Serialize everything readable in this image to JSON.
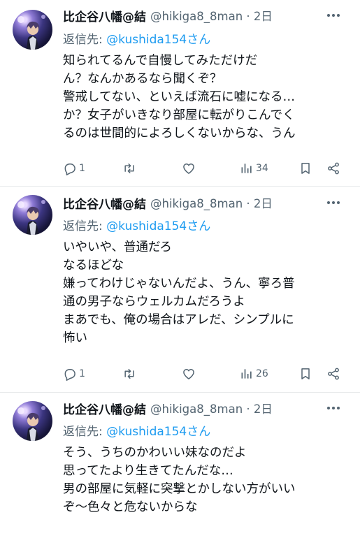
{
  "tweets": [
    {
      "display_name": "比企谷八幡@結",
      "handle_time": "@hikiga8_8man · 2日",
      "reply_prefix": "返信先: ",
      "reply_mention": "@kushida154さん",
      "lines": [
        "知られてるんで自慢してみただけだ",
        "ん？なんかあるなら聞くぞ？",
        "警戒してない、といえば流石に嘘になる…",
        "か？女子がいきなり部屋に転がりこんでく",
        "るのは世間的によろしくないからな、うん"
      ],
      "reply_count": "1",
      "views_count": "34"
    },
    {
      "display_name": "比企谷八幡@結",
      "handle_time": "@hikiga8_8man · 2日",
      "reply_prefix": "返信先: ",
      "reply_mention": "@kushida154さん",
      "lines": [
        "いやいや、普通だろ",
        "なるほどな",
        "嫌ってわけじゃないんだよ、うん、寧ろ普",
        "通の男子ならウェルカムだろうよ",
        "まあでも、俺の場合はアレだ、シンプルに",
        "怖い"
      ],
      "reply_count": "1",
      "views_count": "26"
    },
    {
      "display_name": "比企谷八幡@結",
      "handle_time": "@hikiga8_8man · 2日",
      "reply_prefix": "返信先: ",
      "reply_mention": "@kushida154さん",
      "lines": [
        "そう、うちのかわいい妹なのだよ",
        "思ってたより生きてたんだな…",
        "男の部屋に気軽に突撃とかしない方がいい",
        "ぞ～色々と危ないからな"
      ]
    }
  ],
  "icons": [
    "more-icon",
    "reply-icon",
    "retweet-icon",
    "like-icon",
    "views-icon",
    "bookmark-icon",
    "share-icon"
  ],
  "colors": {
    "text": "#0f1419",
    "muted": "#536471",
    "link": "#1d9bf0",
    "divider": "#e7e9ea"
  }
}
